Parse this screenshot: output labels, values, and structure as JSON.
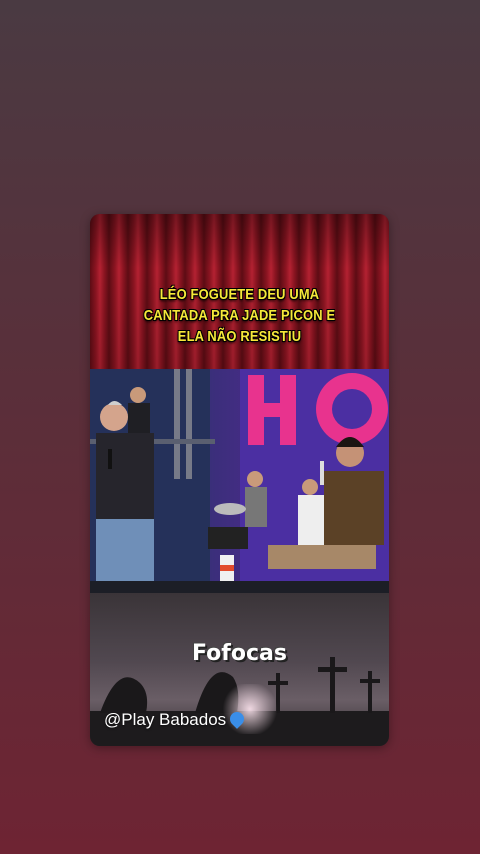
{
  "post": {
    "headline_lines": [
      "LÉO FOGUETE DEU UMA",
      "CANTADA PRA JADE PICON E",
      "ELA NÃO RESISTIU"
    ],
    "brand": "Fofocas",
    "handle": "@Play Babados"
  },
  "colors": {
    "background_top": "#4a3a42",
    "background_bottom": "#6e2433",
    "headline_text": "#f6e83a",
    "curtain_red": "#b52232",
    "handle_drop_icon": "#3a8ee8"
  },
  "icons": {
    "handle_icon": "blue-drop-icon"
  }
}
